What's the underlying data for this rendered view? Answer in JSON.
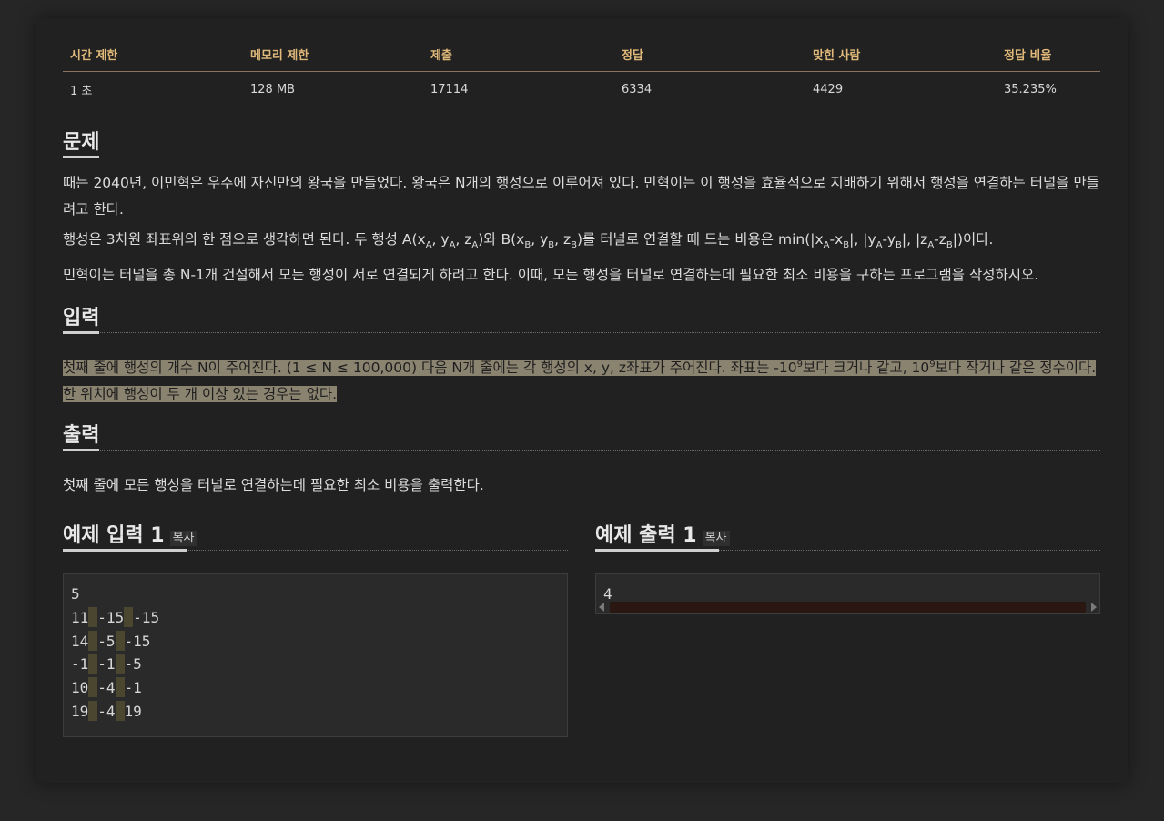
{
  "stats": {
    "headers": [
      "시간 제한",
      "메모리 제한",
      "제출",
      "정답",
      "맞힌 사람",
      "정답 비율"
    ],
    "values": [
      "1 초",
      "128 MB",
      "17114",
      "6334",
      "4429",
      "35.235%"
    ]
  },
  "problem": {
    "title": "문제",
    "p1": "때는 2040년, 이민혁은 우주에 자신만의 왕국을 만들었다. 왕국은 N개의 행성으로 이루어져 있다. 민혁이는 이 행성을 효율적으로 지배하기 위해서 행성을 연결하는 터널을 만들려고 한다.",
    "p2": {
      "a": "행성은 3차원 좌표위의 한 점으로 생각하면 된다. 두 행성 A(x",
      "sA1": "A",
      "b": ", y",
      "sA2": "A",
      "c": ", z",
      "sA3": "A",
      "d": ")와 B(x",
      "sB1": "B",
      "e": ", y",
      "sB2": "B",
      "f": ", z",
      "sB3": "B",
      "g": ")를 터널로 연결할 때 드는 비용은 min(|x",
      "m1": "A",
      "h": "-x",
      "m2": "B",
      "i": "|, |y",
      "m3": "A",
      "j": "-y",
      "m4": "B",
      "k": "|, |z",
      "m5": "A",
      "l": "-z",
      "m6": "B",
      "m": "|)이다."
    },
    "p3": "민혁이는 터널을 총 N-1개 건설해서 모든 행성이 서로 연결되게 하려고 한다. 이때, 모든 행성을 터널로 연결하는데 필요한 최소 비용을 구하는 프로그램을 작성하시오."
  },
  "input": {
    "title": "입력",
    "a": "첫째 줄에 행성의 개수 N이 주어진다. (1 ≤ N ≤ 100,000) 다음 N개 줄에는 각 행성의 x, y, z좌표가 주어진다. 좌표는 -10",
    "sup1": "9",
    "b": "보다 크거나 같고, 10",
    "sup2": "9",
    "c": "보다 작거나 같은 정수이다.",
    "line2": "한 위치에 행성이 두 개 이상 있는 경우는 없다."
  },
  "output": {
    "title": "출력",
    "text": "첫째 줄에 모든 행성을 터널로 연결하는데 필요한 최소 비용을 출력한다."
  },
  "example_input": {
    "title": "예제 입력 1",
    "copy": "복사",
    "lines": [
      [
        "5"
      ],
      [
        "11",
        "-15",
        "-15"
      ],
      [
        "14",
        "-5",
        "-15"
      ],
      [
        "-1",
        "-1",
        "-5"
      ],
      [
        "10",
        "-4",
        "-1"
      ],
      [
        "19",
        "-4",
        "19"
      ]
    ]
  },
  "example_output": {
    "title": "예제 출력 1",
    "copy": "복사",
    "value": "4"
  }
}
